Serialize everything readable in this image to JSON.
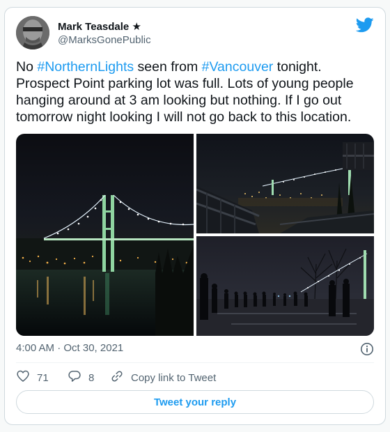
{
  "tweet": {
    "author_name": "Mark Teasdale ★",
    "author_handle": "@MarksGonePublic",
    "text_parts": [
      {
        "text": "No ",
        "type": "text"
      },
      {
        "text": "#NorthernLights",
        "type": "hashtag"
      },
      {
        "text": " seen from ",
        "type": "text"
      },
      {
        "text": "#Vancouver",
        "type": "hashtag"
      },
      {
        "text": " tonight. Prospect Point parking lot was full. Lots of young people hanging around at 3 am looking but nothing. If I go out tomorrow night looking I will not go back to this location.",
        "type": "text"
      }
    ],
    "timestamp": "4:00 AM · Oct 30, 2021"
  },
  "actions": {
    "like_count": "71",
    "reply_count": "8",
    "copy_link_label": "Copy link to Tweet",
    "reply_button_label": "Tweet your reply"
  },
  "icons": {
    "brand": "twitter-bird-icon",
    "info": "info-icon",
    "like": "heart-icon",
    "reply": "reply-icon",
    "copy": "link-icon"
  },
  "colors": {
    "accent": "#1d9bf0",
    "text": "#0f1419",
    "secondary": "#536471",
    "border": "#cfd9de"
  }
}
